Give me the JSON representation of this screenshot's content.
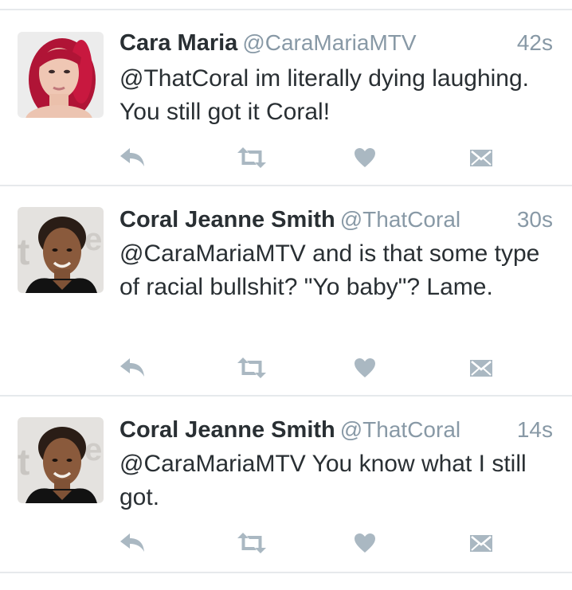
{
  "colors": {
    "name": "#292f33",
    "meta": "#8899a6",
    "icon": "#aab8c2",
    "divider": "#e6e9ec"
  },
  "icons": [
    "reply-icon",
    "retweet-icon",
    "like-icon",
    "direct-message-icon"
  ],
  "tweets": [
    {
      "name": "Cara Maria",
      "handle": "@CaraMariaMTV",
      "time": "42s",
      "text": "@ThatCoral im literally dying laughing. You still got it Coral!"
    },
    {
      "name": "Coral Jeanne Smith",
      "handle": "@ThatCoral",
      "time": "30s",
      "text": "@CaraMariaMTV and is that some type of racial bullshit? \"Yo baby\"? Lame."
    },
    {
      "name": "Coral Jeanne Smith",
      "handle": "@ThatCoral",
      "time": "14s",
      "text": "@CaraMariaMTV You know what I still got."
    }
  ]
}
